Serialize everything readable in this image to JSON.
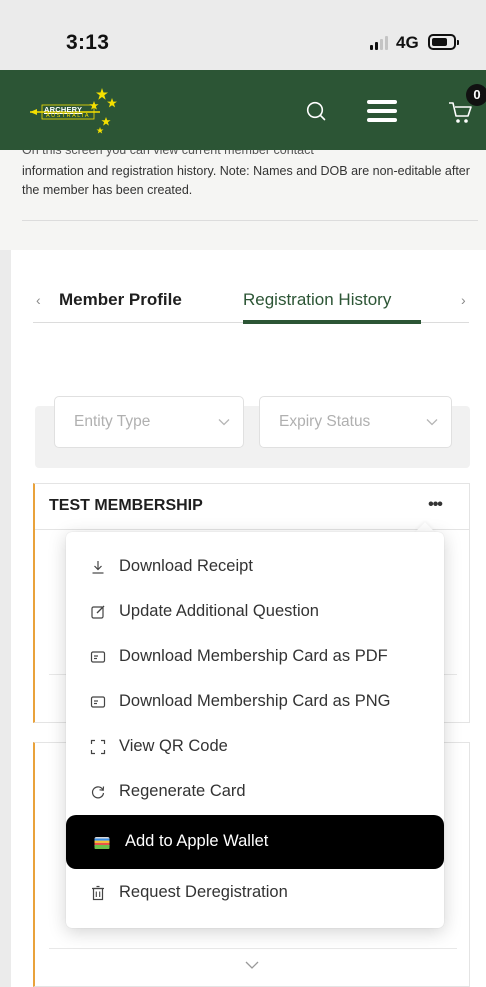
{
  "status_bar": {
    "time": "3:13",
    "network": "4G"
  },
  "header": {
    "logo_line1": "ARCHERY",
    "logo_line2": "AUSTRALIA",
    "cart_count": "0",
    "brand_color": "#2c5535",
    "accent_color": "#f5e000"
  },
  "intro": {
    "cut_line": "On this screen you can view current member contact",
    "text": "information and registration history. Note: Names and DOB are non-editable after the member has been created."
  },
  "tabs": [
    {
      "label": "Member Profile",
      "active": false
    },
    {
      "label": "Registration History",
      "active": true
    }
  ],
  "filters": {
    "entity_type_placeholder": "Entity Type",
    "expiry_status_placeholder": "Expiry Status"
  },
  "membership": {
    "title": "TEST MEMBERSHIP",
    "more_label": "•••",
    "status_color": "#e9a23b"
  },
  "menu": {
    "items": [
      {
        "label": "Download Receipt",
        "icon": "download-icon"
      },
      {
        "label": "Update Additional Question",
        "icon": "edit-icon"
      },
      {
        "label": "Download Membership Card as PDF",
        "icon": "card-icon"
      },
      {
        "label": "Download Membership Card as PNG",
        "icon": "card-icon"
      },
      {
        "label": "View QR Code",
        "icon": "qr-scan-icon"
      },
      {
        "label": "Regenerate Card",
        "icon": "refresh-icon"
      },
      {
        "label": "Add to Apple Wallet",
        "icon": "apple-wallet-icon",
        "highlighted": true
      },
      {
        "label": "Request Deregistration",
        "icon": "trash-icon"
      }
    ]
  }
}
